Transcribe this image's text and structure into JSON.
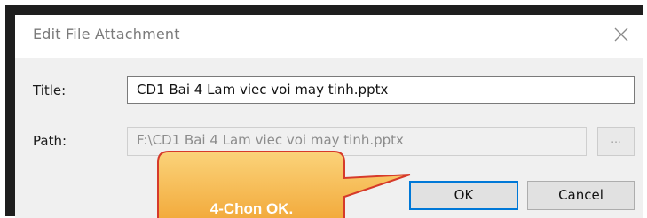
{
  "dialog": {
    "title": "Edit File Attachment",
    "close_icon": "close-icon"
  },
  "form": {
    "title_label": "Title:",
    "title_value": "CD1 Bai 4 Lam viec voi may tinh.pptx",
    "path_label": "Path:",
    "path_value": "F:\\CD1 Bai 4 Lam viec voi may tinh.pptx",
    "browse_label": "..."
  },
  "buttons": {
    "ok_label": "OK",
    "cancel_label": "Cancel"
  },
  "callout": {
    "text": "4-Chon OK.",
    "fill_color": "#f5b33f",
    "border_color": "#d63a2a"
  },
  "colors": {
    "dialog_bg": "#f0f0f0",
    "default_button_border": "#0078d7"
  }
}
